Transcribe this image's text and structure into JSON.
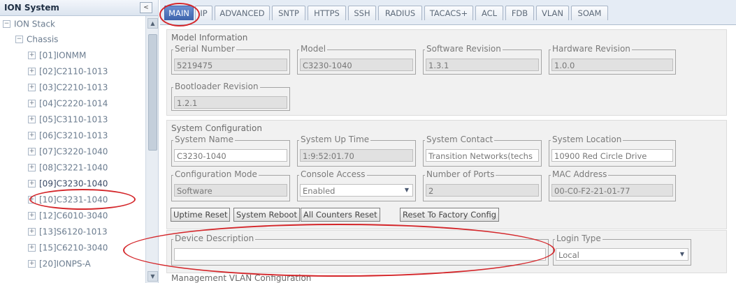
{
  "tree": {
    "title": "ION System",
    "collapse_icon": "<",
    "items": [
      {
        "toggle": "−",
        "label": "ION Stack"
      },
      {
        "toggle": "−",
        "label": "Chassis"
      },
      {
        "toggle": "+",
        "label": "[01]IONMM"
      },
      {
        "toggle": "+",
        "label": "[02]C2110-1013"
      },
      {
        "toggle": "+",
        "label": "[03]C2210-1013"
      },
      {
        "toggle": "+",
        "label": "[04]C2220-1014"
      },
      {
        "toggle": "+",
        "label": "[05]C3110-1013"
      },
      {
        "toggle": "+",
        "label": "[06]C3210-1013"
      },
      {
        "toggle": "+",
        "label": "[07]C3220-1040"
      },
      {
        "toggle": "+",
        "label": "[08]C3221-1040"
      },
      {
        "toggle": "+",
        "label": "[09]C3230-1040"
      },
      {
        "toggle": "+",
        "label": "[10]C3231-1040"
      },
      {
        "toggle": "+",
        "label": "[12]C6010-3040"
      },
      {
        "toggle": "+",
        "label": "[13]S6120-1013"
      },
      {
        "toggle": "+",
        "label": "[15]C6210-3040"
      },
      {
        "toggle": "+",
        "label": "[20]IONPS-A"
      }
    ]
  },
  "tabs": [
    "MAIN",
    "IP",
    "ADVANCED",
    "SNTP",
    "HTTPS",
    "SSH",
    "RADIUS",
    "TACACS+",
    "ACL",
    "FDB",
    "VLAN",
    "SOAM"
  ],
  "active_tab": "MAIN",
  "model_info": {
    "title": "Model Information",
    "serial_label": "Serial Number",
    "serial_value": "5219475",
    "model_label": "Model",
    "model_value": "C3230-1040",
    "sw_label": "Software Revision",
    "sw_value": "1.3.1",
    "hw_label": "Hardware Revision",
    "hw_value": "1.0.0",
    "boot_label": "Bootloader Revision",
    "boot_value": "1.2.1"
  },
  "system_config": {
    "title": "System Configuration",
    "name_label": "System Name",
    "name_value": "C3230-1040",
    "uptime_label": "System Up Time",
    "uptime_value": "1:9:52:01.70",
    "contact_label": "System Contact",
    "contact_value": "Transition Networks(techs",
    "location_label": "System Location",
    "location_value": "10900 Red Circle Drive",
    "config_mode_label": "Configuration Mode",
    "config_mode_value": "Software",
    "console_label": "Console Access",
    "console_value": "Enabled",
    "ports_label": "Number of Ports",
    "ports_value": "2",
    "mac_label": "MAC Address",
    "mac_value": "00-C0-F2-21-01-77",
    "buttons": {
      "uptime_reset": "Uptime Reset",
      "system_reboot": "System Reboot",
      "counters_reset": "All Counters Reset",
      "factory_reset": "Reset To Factory Config"
    }
  },
  "device_description": {
    "label": "Device Description",
    "value": ""
  },
  "login": {
    "label": "Login Type",
    "value": "Local"
  },
  "mgmt_vlan": {
    "title": "Management VLAN Configuration"
  },
  "icons": {
    "dropdown": "▼",
    "scroll_up": "▲",
    "scroll_down": "▼"
  },
  "colors": {
    "accent": "#3c63ac",
    "annotation": "#d4262a"
  }
}
